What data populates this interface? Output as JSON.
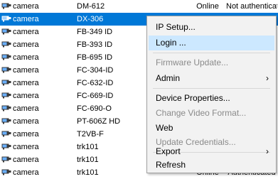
{
  "devices": [
    {
      "type": "camera",
      "name": "DM-612",
      "status": "Online",
      "auth": "Not authenticated",
      "selected": false
    },
    {
      "type": "camera",
      "name": "DX-306",
      "status": "",
      "auth": "",
      "selected": true
    },
    {
      "type": "camera",
      "name": "FB-349 ID",
      "status": "",
      "auth": "",
      "selected": false
    },
    {
      "type": "camera",
      "name": "FB-393 ID",
      "status": "",
      "auth": "",
      "selected": false
    },
    {
      "type": "camera",
      "name": "FB-695 ID",
      "status": "",
      "auth": "",
      "selected": false
    },
    {
      "type": "camera",
      "name": "FC-304-ID",
      "status": "",
      "auth": "",
      "selected": false
    },
    {
      "type": "camera",
      "name": "FC-632-ID",
      "status": "",
      "auth": "",
      "selected": false
    },
    {
      "type": "camera",
      "name": "FC-669-ID",
      "status": "",
      "auth": "",
      "selected": false
    },
    {
      "type": "camera",
      "name": "FC-690-O",
      "status": "",
      "auth": "",
      "selected": false
    },
    {
      "type": "camera",
      "name": "PT-606Z HD",
      "status": "",
      "auth": "",
      "selected": false
    },
    {
      "type": "camera",
      "name": "T2VB-F",
      "status": "",
      "auth": "",
      "selected": false
    },
    {
      "type": "camera",
      "name": "trk101",
      "status": "",
      "auth": "",
      "selected": false
    },
    {
      "type": "camera",
      "name": "trk101",
      "status": "",
      "auth": "",
      "selected": false
    },
    {
      "type": "camera",
      "name": "trk101",
      "status": "Online",
      "auth": "Authenticated",
      "selected": false
    }
  ],
  "context_menu": {
    "items": [
      {
        "label": "IP Setup...",
        "disabled": false,
        "submenu": false,
        "hover": false
      },
      {
        "label": "Login ...",
        "disabled": false,
        "submenu": false,
        "hover": true
      },
      {
        "label": "Firmware Update...",
        "disabled": true,
        "submenu": false,
        "hover": false
      },
      {
        "label": "Admin",
        "disabled": false,
        "submenu": true,
        "hover": false
      },
      {
        "label": "Device Properties...",
        "disabled": false,
        "submenu": false,
        "hover": false
      },
      {
        "label": "Change Video Format...",
        "disabled": true,
        "submenu": false,
        "hover": false
      },
      {
        "label": "Web",
        "disabled": false,
        "submenu": false,
        "hover": false
      },
      {
        "label": "Update Credentials...",
        "disabled": true,
        "submenu": false,
        "hover": false
      },
      {
        "label": "Export",
        "disabled": false,
        "submenu": true,
        "hover": false
      },
      {
        "label": "Refresh",
        "disabled": false,
        "submenu": false,
        "hover": false
      }
    ],
    "submenu_arrow": "›"
  },
  "icons": {
    "device_icon": "camera-icon"
  },
  "colors": {
    "selection": "#0078d7",
    "menu_hover": "#cce8ff",
    "menu_background": "#f2f2f2",
    "disabled_text": "#8a8a8a"
  }
}
